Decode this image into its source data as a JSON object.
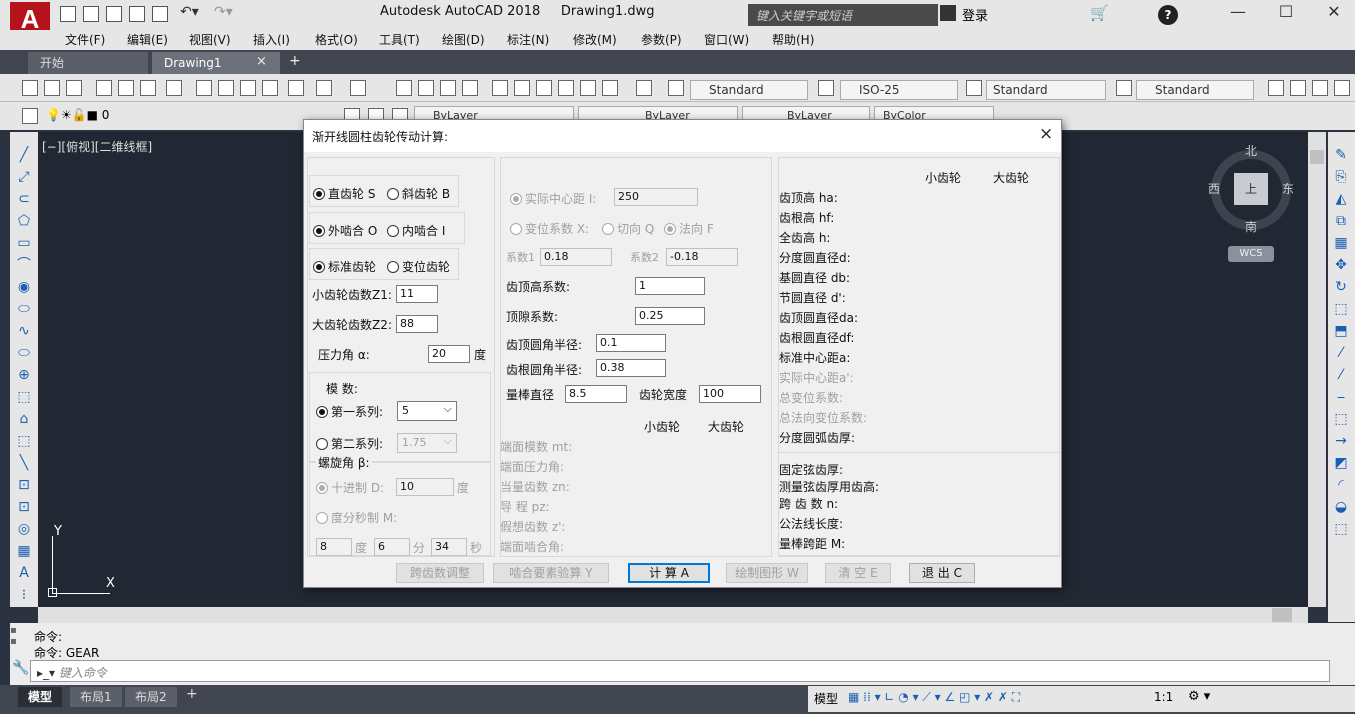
{
  "app": {
    "logo_letter": "A",
    "title": "Autodesk AutoCAD 2018",
    "file": "Drawing1.dwg",
    "search_placeholder": "键入关键字或短语",
    "login": "登录",
    "help": "?"
  },
  "menu": [
    "文件(F)",
    "编辑(E)",
    "视图(V)",
    "插入(I)",
    "格式(O)",
    "工具(T)",
    "绘图(D)",
    "标注(N)",
    "修改(M)",
    "参数(P)",
    "窗口(W)",
    "帮助(H)"
  ],
  "tabs": {
    "start": "开始",
    "drawing": "Drawing1",
    "close": "×",
    "add": "+"
  },
  "toolbar": {
    "text_style": "Standard",
    "dim_style": "ISO-25",
    "table_style": "Standard",
    "mleader_style": "Standard",
    "layer": "0",
    "linetype1": "ByLayer",
    "linetype2": "ByLayer",
    "lineweight": "ByLayer",
    "color": "ByColor"
  },
  "viewport": {
    "label": "[−][俯视][二维线框]",
    "compass": {
      "north": "北",
      "south": "南",
      "east": "东",
      "west": "西",
      "top": "上"
    },
    "wcs": "WCS",
    "axis_x": "X",
    "axis_y": "Y"
  },
  "command": {
    "line1": "命令:",
    "line2": "命令: GEAR",
    "placeholder": "键入命令"
  },
  "layout_tabs": [
    "模型",
    "布局1",
    "布局2"
  ],
  "status": {
    "model": "模型",
    "scale": "1:1"
  },
  "dialog": {
    "title": "渐开线圆柱齿轮传动计算:",
    "close": "×",
    "gear_type": {
      "spur": "直齿轮 S",
      "helical": "斜齿轮 B"
    },
    "mesh": {
      "external": "外啮合 O",
      "internal": "内啮合 I"
    },
    "std": {
      "standard": "标准齿轮",
      "modified": "变位齿轮"
    },
    "z1_label": "小齿轮齿数Z1:",
    "z1": "11",
    "z2_label": "大齿轮齿数Z2:",
    "z2": "88",
    "pressure_label": "压力角 α:",
    "pressure": "20",
    "deg": "度",
    "module_label": "模  数:",
    "series1": "第一系列:",
    "series1_val": "5",
    "series2": "第二系列:",
    "series2_val": "1.75",
    "helix_label": "螺旋角 β:",
    "decimal": "十进制 D:",
    "decimal_val": "10",
    "decimal_unit": "度",
    "dms": "度分秒制 M:",
    "dms_d": "8",
    "dms_du": "度",
    "dms_m": "6",
    "dms_mu": "分",
    "dms_s": "34",
    "dms_su": "秒",
    "actual_center": "实际中心距 I:",
    "actual_center_val": "250",
    "shift_coef": "变位系数 X:",
    "tangent": "切向 Q",
    "normal": "法向 F",
    "coef1": "系数1",
    "coef1_val": "0.18",
    "coef2": "系数2",
    "coef2_val": "-0.18",
    "addendum_coef": "齿顶高系数:",
    "addendum_coef_val": "1",
    "clearance_coef": "顶隙系数:",
    "clearance_coef_val": "0.25",
    "tip_fillet": "齿顶圆角半径:",
    "tip_fillet_val": "0.1",
    "root_fillet": "齿根圆角半径:",
    "root_fillet_val": "0.38",
    "pin_dia": "量棒直径",
    "pin_dia_val": "8.5",
    "face_width": "齿轮宽度",
    "face_width_val": "100",
    "small_gear": "小齿轮",
    "large_gear": "大齿轮",
    "mid_results": [
      "端面模数 mt:",
      "端面压力角:",
      "当量齿数 zn:",
      "导  程 pz:",
      "假想齿数 z':",
      "端面啮合角:"
    ],
    "right_results": [
      "齿顶高 ha:",
      "齿根高 hf:",
      "全齿高 h:",
      "分度圆直径d:",
      "基圆直径 db:",
      "节圆直径 d':",
      "齿顶圆直径da:",
      "齿根圆直径df:",
      "标准中心距a:"
    ],
    "right_results_dis": [
      "实际中心距a':",
      "总变位系数:",
      "总法向变位系数:"
    ],
    "right_results2": [
      "分度圆弧齿厚:"
    ],
    "right_results3": [
      "固定弦齿厚:",
      "测量弦齿厚用齿高:",
      "跨 齿 数 n:",
      "公法线长度:",
      "量棒跨距 M:"
    ],
    "buttons": {
      "span": "跨齿数调整",
      "mesh_check": "啮合要素验算 Y",
      "calc": "计  算 A",
      "draw": "绘制图形 W",
      "clear": "清 空 E",
      "exit": "退 出 C"
    }
  }
}
